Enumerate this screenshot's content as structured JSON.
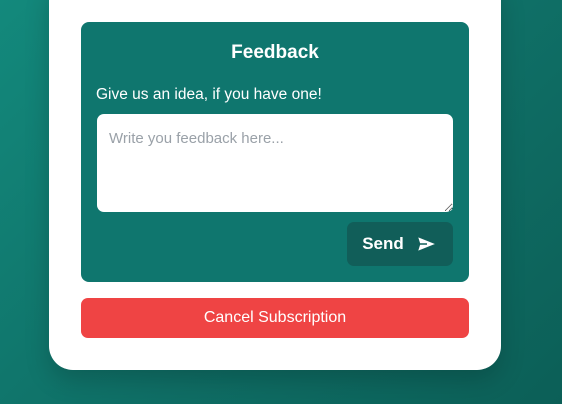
{
  "feedback": {
    "title": "Feedback",
    "prompt": "Give us an idea, if you have one!",
    "placeholder": "Write you feedback here...",
    "value": "",
    "send_label": "Send",
    "send_icon": "send-arrow-icon"
  },
  "subscription": {
    "cancel_label": "Cancel Subscription"
  },
  "colors": {
    "background_gradient_start": "#13897c",
    "background_gradient_end": "#0c5f57",
    "panel": "#0f766e",
    "send_button": "#115e59",
    "cancel_button": "#ef4444",
    "card": "#ffffff"
  }
}
